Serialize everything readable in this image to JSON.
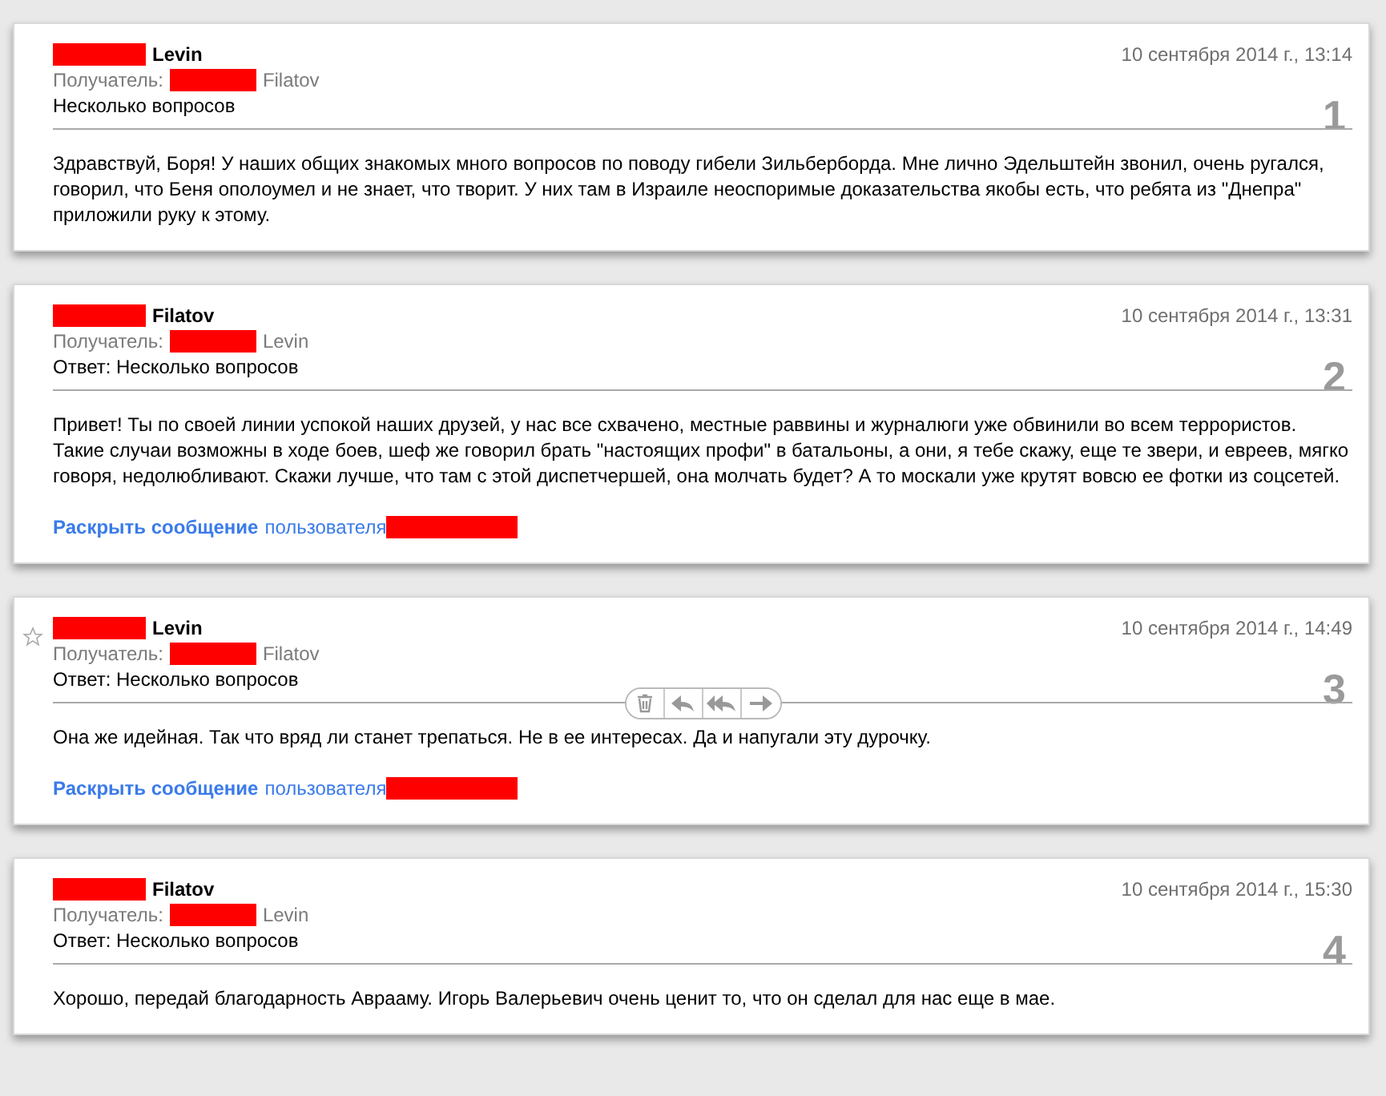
{
  "messages": [
    {
      "sender": "Levin",
      "date": "10 сентября 2014 г., 13:14",
      "recipient_label": "Получатель:",
      "recipient": "Filatov",
      "subject": "Несколько вопросов",
      "number": "1",
      "star_shown": false,
      "toolbar_shown": false,
      "body": "Здравствуй, Боря! У наших общих знакомых много вопросов по поводу гибели Зильберборда. Мне лично Эдельштейн звонил, очень ругался, говорил, что Беня ополоумел и не знает, что творит. У них там в Израиле неоспоримые доказательства якобы есть, что ребята из \"Днепра\" приложили руку к этому."
    },
    {
      "sender": "Filatov",
      "date": "10 сентября 2014 г., 13:31",
      "recipient_label": "Получатель:",
      "recipient": "Levin",
      "subject": "Ответ: Несколько вопросов",
      "number": "2",
      "star_shown": false,
      "toolbar_shown": false,
      "body": "Привет! Ты по своей линии успокой наших друзей, у нас все схвачено, местные раввины и журналюги уже обвинили во всем террористов. Такие случаи возможны в ходе боев, шеф же говорил брать \"настоящих профи\" в батальоны, а они, я тебе скажу, еще те звери, и евреев, мягко говоря, недолюбливают. Скажи лучше, что там с этой диспетчершей, она молчать будет? А то москали уже крутят вовсю ее фотки из соцсетей.",
      "expand_link": "Раскрыть сообщение",
      "expand_suffix": "пользователя"
    },
    {
      "sender": "Levin",
      "date": "10 сентября 2014 г., 14:49",
      "recipient_label": "Получатель:",
      "recipient": "Filatov",
      "subject": "Ответ: Несколько вопросов",
      "number": "3",
      "star_shown": true,
      "toolbar_shown": true,
      "body": "Она же идейная. Так что вряд ли станет трепаться. Не в ее интересах. Да и напугали эту дурочку.",
      "expand_link": "Раскрыть сообщение",
      "expand_suffix": "пользователя"
    },
    {
      "sender": "Filatov",
      "date": "10 сентября 2014 г., 15:30",
      "recipient_label": "Получатель:",
      "recipient": "Levin",
      "subject": "Ответ: Несколько вопросов",
      "number": "4",
      "star_shown": false,
      "toolbar_shown": false,
      "body": "Хорошо, передай благодарность Аврааму. Игорь Валерьевич очень ценит то, что он сделал для нас еще в мае."
    }
  ]
}
